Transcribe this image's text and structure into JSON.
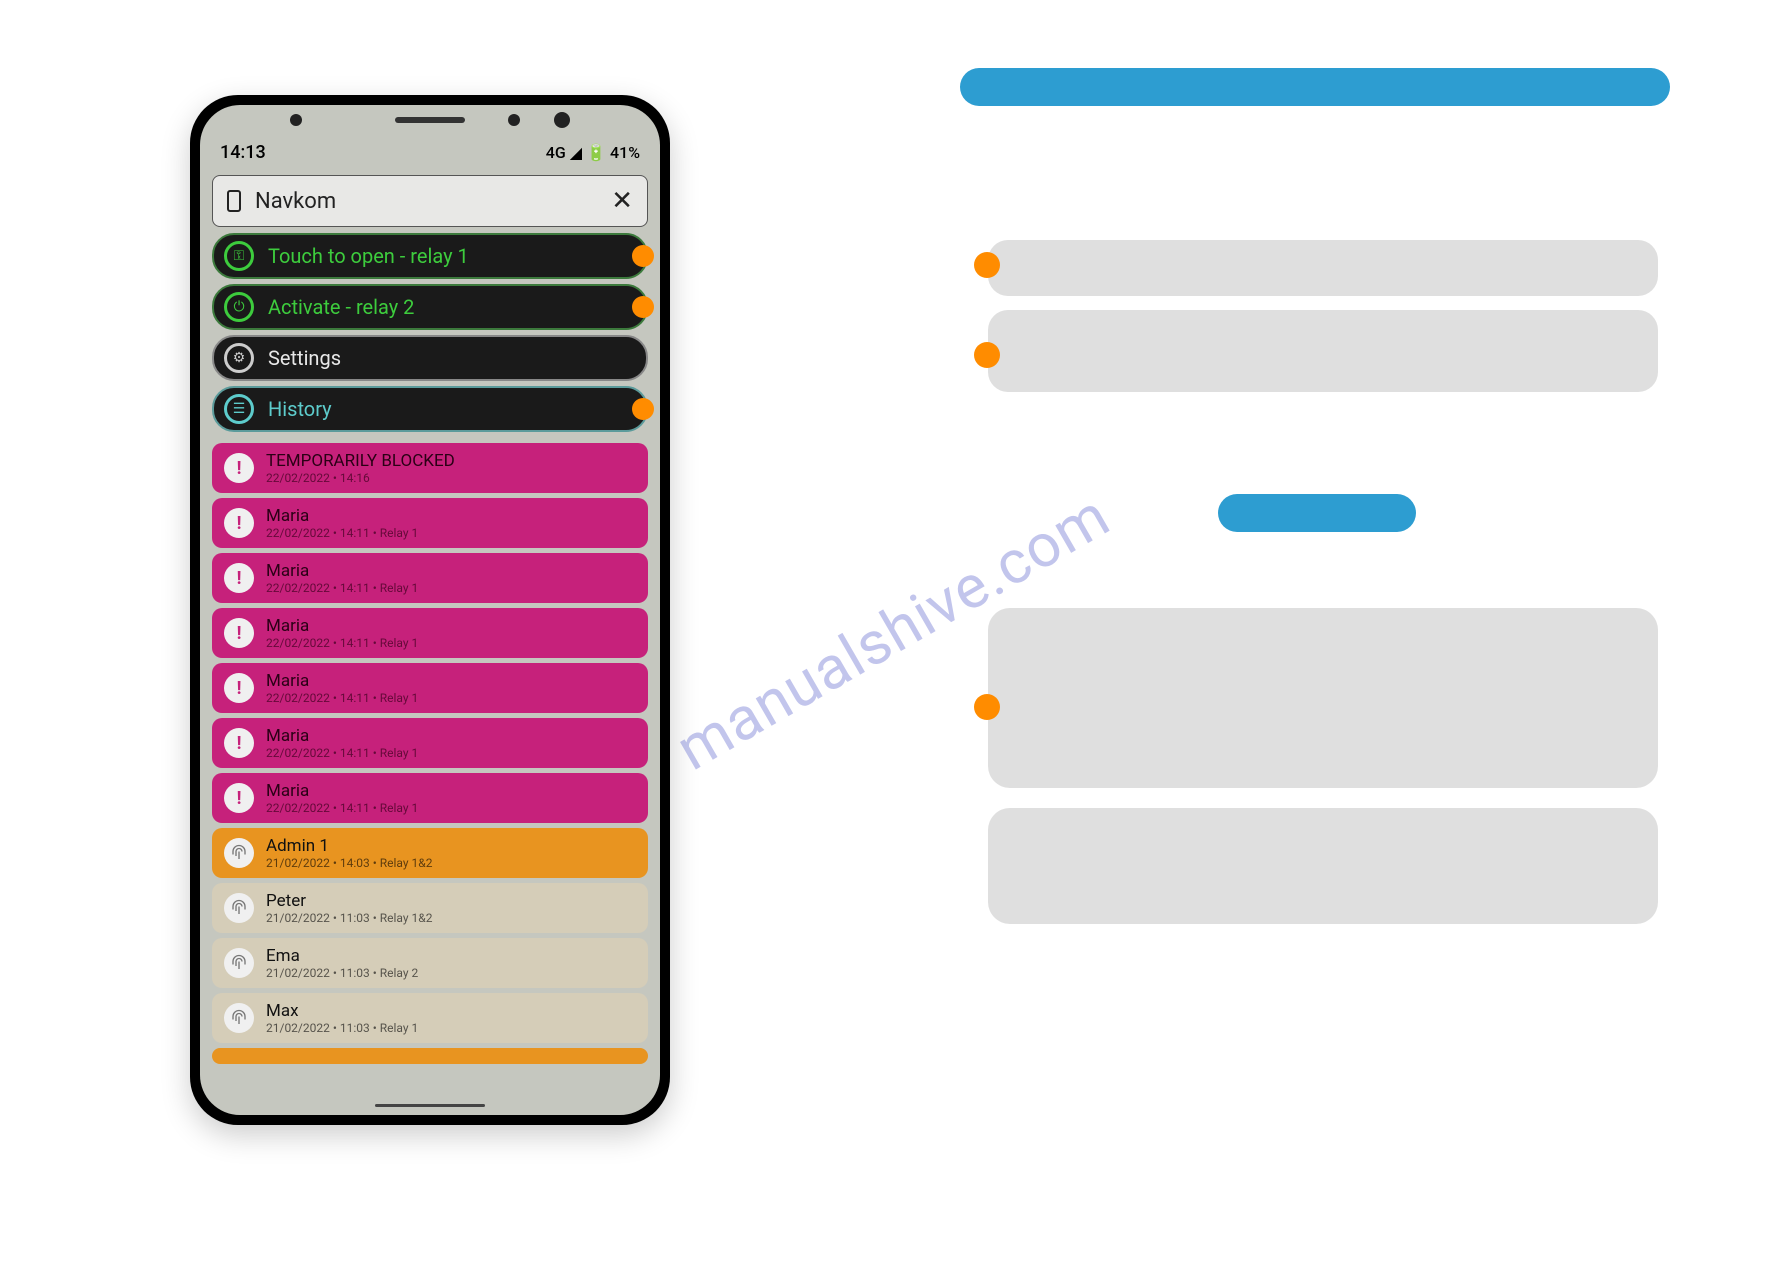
{
  "statusbar": {
    "time": "14:13",
    "network": "4G",
    "battery": "41%"
  },
  "header": {
    "title": "Navkom"
  },
  "menu": {
    "relay1": "Touch to open - relay 1",
    "relay2": "Activate - relay 2",
    "settings": "Settings",
    "history": "History"
  },
  "history": [
    {
      "name": "TEMPORARILY BLOCKED",
      "meta": "22/02/2022 • 14:16",
      "style": "magenta",
      "icon": "!"
    },
    {
      "name": "Maria",
      "meta": "22/02/2022 • 14:11 • Relay 1",
      "style": "magenta",
      "icon": "!"
    },
    {
      "name": "Maria",
      "meta": "22/02/2022 • 14:11 • Relay 1",
      "style": "magenta",
      "icon": "!"
    },
    {
      "name": "Maria",
      "meta": "22/02/2022 • 14:11 • Relay 1",
      "style": "magenta",
      "icon": "!"
    },
    {
      "name": "Maria",
      "meta": "22/02/2022 • 14:11 • Relay 1",
      "style": "magenta",
      "icon": "!"
    },
    {
      "name": "Maria",
      "meta": "22/02/2022 • 14:11 • Relay 1",
      "style": "magenta",
      "icon": "!"
    },
    {
      "name": "Maria",
      "meta": "22/02/2022 • 14:11 • Relay 1",
      "style": "magenta",
      "icon": "!"
    },
    {
      "name": "Admin 1",
      "meta": "21/02/2022 • 14:03 • Relay 1&2",
      "style": "orange",
      "icon": "fp"
    },
    {
      "name": "Peter",
      "meta": "21/02/2022 • 11:03 • Relay 1&2",
      "style": "tan",
      "icon": "fp"
    },
    {
      "name": "Ema",
      "meta": "21/02/2022 • 11:03 • Relay 2",
      "style": "tan",
      "icon": "fp"
    },
    {
      "name": "Max",
      "meta": "21/02/2022 • 11:03 • Relay 1",
      "style": "tan",
      "icon": "fp"
    }
  ],
  "watermark": "manualshive.com"
}
